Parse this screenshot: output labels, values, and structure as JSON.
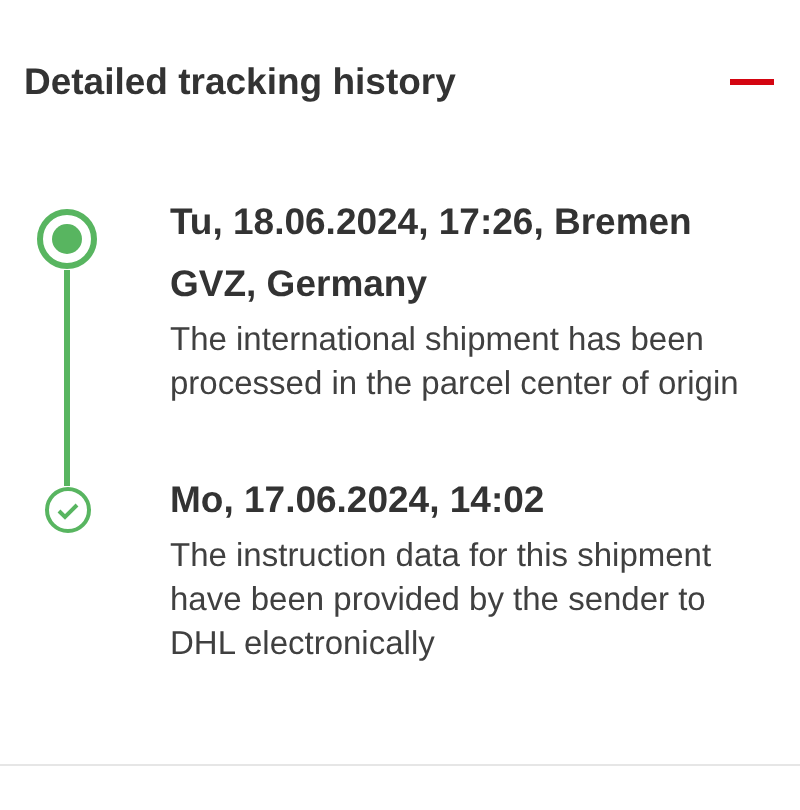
{
  "section": {
    "title": "Detailed tracking history",
    "expanded": true
  },
  "events": [
    {
      "title": "Tu, 18.06.2024, 17:26, Bremen GVZ, Germany",
      "description": "The international shipment has been processed in the parcel center of origin",
      "current": true
    },
    {
      "title": "Mo, 17.06.2024, 14:02",
      "description": "The instruction data for this shipment have been provided by the sender to DHL electronically",
      "current": false
    }
  ]
}
